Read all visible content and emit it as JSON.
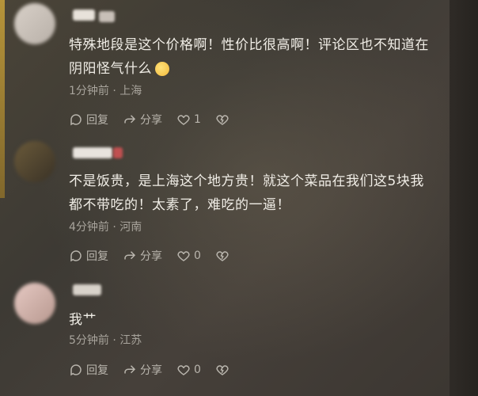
{
  "comments": [
    {
      "text": "特殊地段是这个价格啊！性价比很高啊！评论区也不知道在阴阳怪气什么",
      "time": "1分钟前",
      "location": "上海",
      "reply_label": "回复",
      "share_label": "分享",
      "like_count": "1"
    },
    {
      "text": "不是饭贵，是上海这个地方贵！就这个菜品在我们这5块我都不带吃的！太素了，难吃的一逼！",
      "time": "4分钟前",
      "location": "河南",
      "reply_label": "回复",
      "share_label": "分享",
      "like_count": "0"
    },
    {
      "text": "我艹",
      "time": "5分钟前",
      "location": "江苏",
      "reply_label": "回复",
      "share_label": "分享",
      "like_count": "0"
    }
  ],
  "separator": "·",
  "icons": {
    "reply": "reply-icon",
    "share": "share-icon",
    "like": "heart-icon",
    "dislike": "broken-heart-icon",
    "emoji": "thinking-emoji-icon"
  }
}
